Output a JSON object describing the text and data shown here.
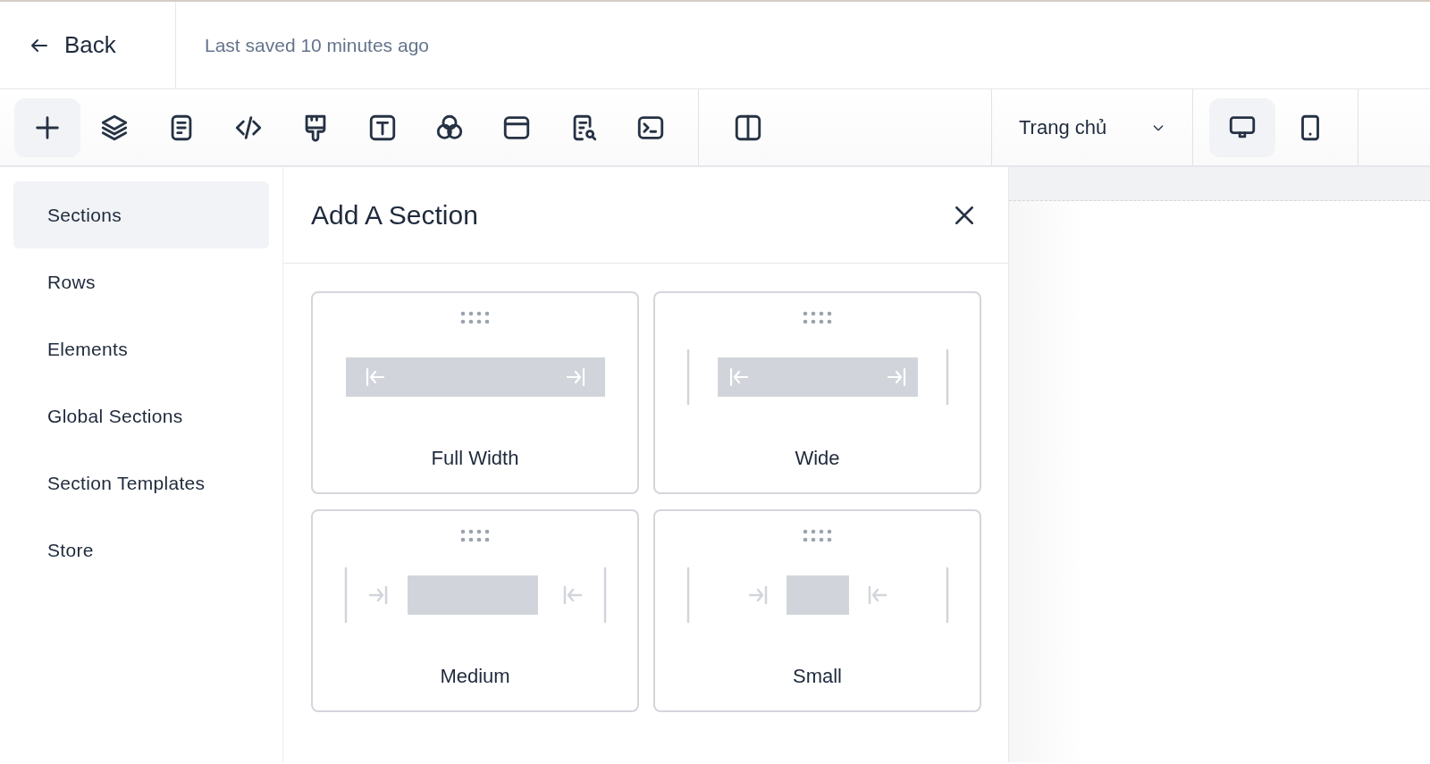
{
  "header": {
    "back": "Back",
    "last_saved": "Last saved 10 minutes ago"
  },
  "toolbar": {
    "tools": [
      {
        "kind": "add",
        "selected": true
      },
      {
        "kind": "layers",
        "selected": false
      },
      {
        "kind": "page",
        "selected": false
      },
      {
        "kind": "code",
        "selected": false
      },
      {
        "kind": "brush",
        "selected": false
      },
      {
        "kind": "text",
        "selected": false
      },
      {
        "kind": "circles",
        "selected": false
      },
      {
        "kind": "window",
        "selected": false
      },
      {
        "kind": "doc-search",
        "selected": false
      },
      {
        "kind": "terminal",
        "selected": false
      }
    ],
    "layout_tool": {
      "kind": "columns",
      "selected": false
    },
    "page_select": {
      "value": "Trang chủ"
    },
    "devices": [
      {
        "kind": "desktop",
        "selected": true
      },
      {
        "kind": "mobile",
        "selected": false
      }
    ]
  },
  "sidebar": {
    "items": [
      {
        "label": "Sections",
        "selected": true
      },
      {
        "label": "Rows",
        "selected": false
      },
      {
        "label": "Elements",
        "selected": false
      },
      {
        "label": "Global Sections",
        "selected": false
      },
      {
        "label": "Section Templates",
        "selected": false
      },
      {
        "label": "Store",
        "selected": false
      }
    ]
  },
  "panel": {
    "title": "Add A Section",
    "options": [
      {
        "kind": "full",
        "label": "Full Width"
      },
      {
        "kind": "wide",
        "label": "Wide"
      },
      {
        "kind": "medium",
        "label": "Medium"
      },
      {
        "kind": "small",
        "label": "Small"
      }
    ]
  }
}
